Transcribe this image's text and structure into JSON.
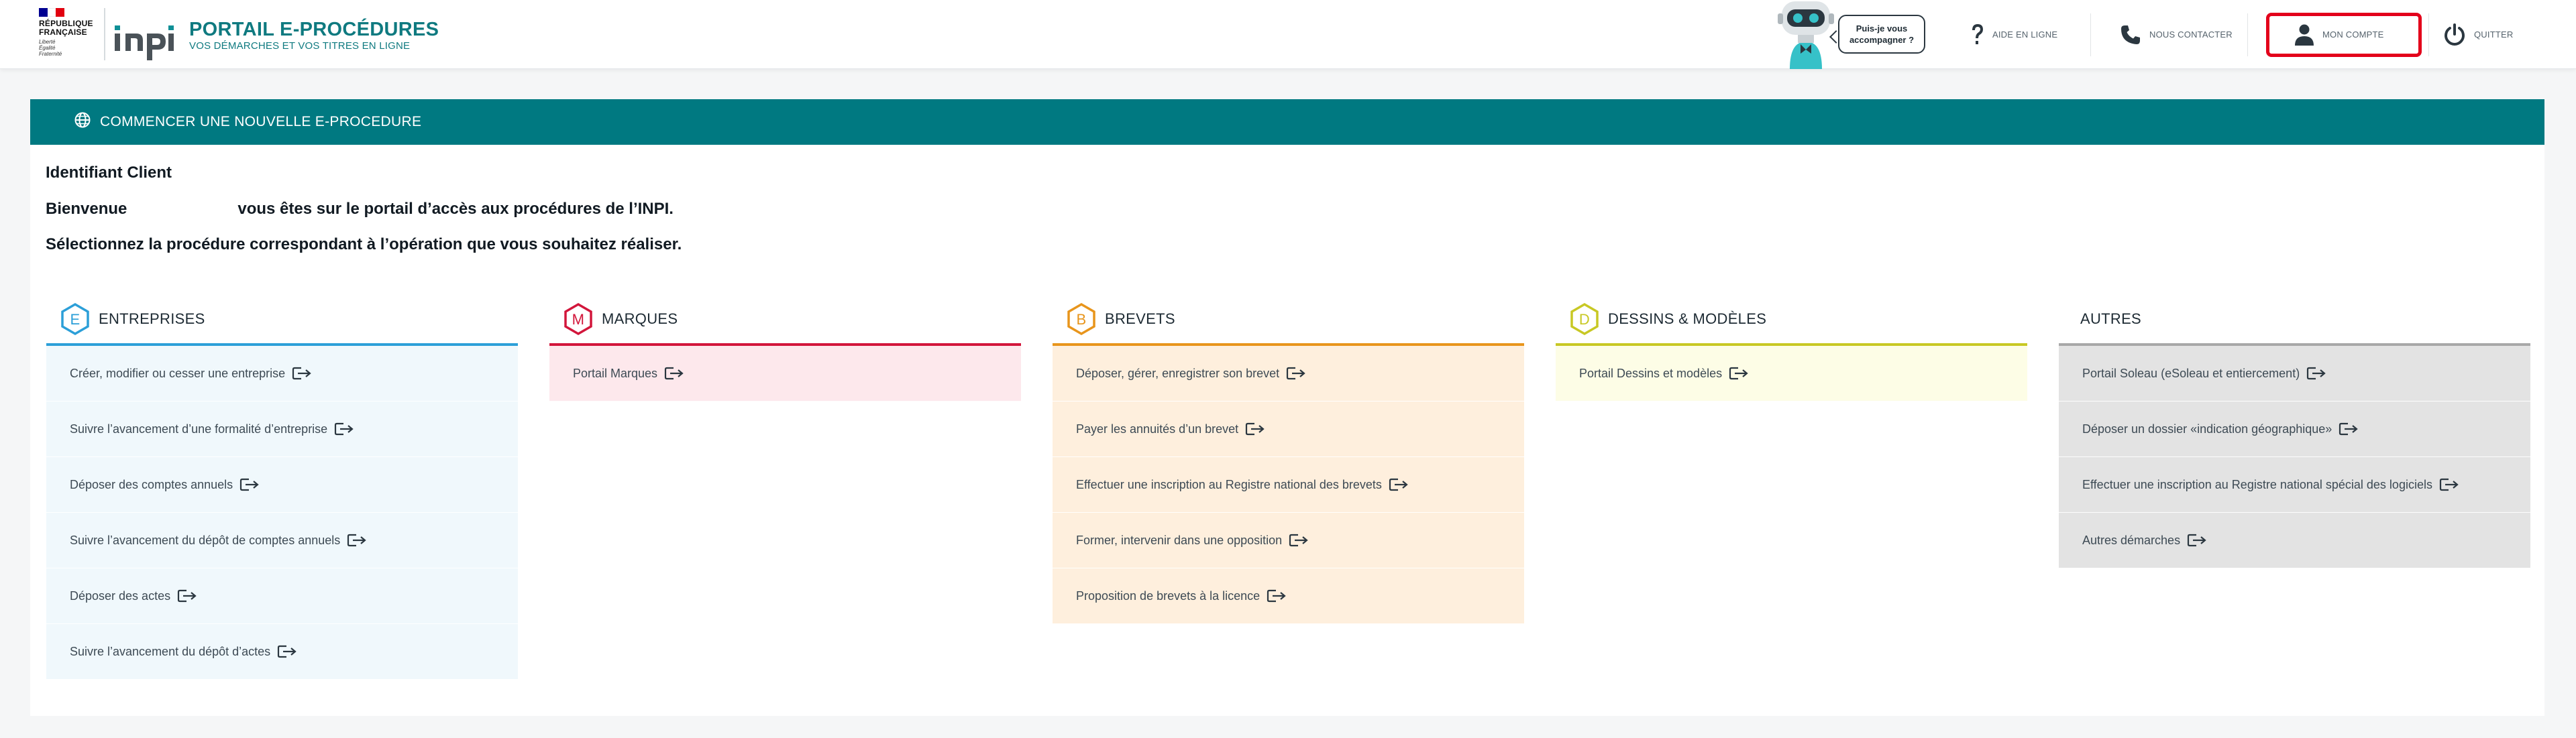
{
  "header": {
    "republique_lines": [
      "RÉPUBLIQUE",
      "FRANÇAISE"
    ],
    "motto_lines": [
      "Liberté",
      "Égalité",
      "Fraternité"
    ],
    "brand": "inpi",
    "portal_title": "PORTAIL E-PROCÉDURES",
    "portal_subtitle": "VOS DÉMARCHES ET VOS TITRES EN LIGNE",
    "assistant_bubble_line1": "Puis-je vous",
    "assistant_bubble_line2": "accompagner ?",
    "nav": {
      "help": "AIDE EN LIGNE",
      "contact": "NOUS CONTACTER",
      "account": "MON COMPTE",
      "quit": "QUITTER"
    }
  },
  "bar": {
    "label": "COMMENCER UNE NOUVELLE E-PROCEDURE"
  },
  "intro": {
    "client_id": "Identifiant Client",
    "welcome_prefix": "Bienvenue",
    "welcome_suffix": "vous êtes sur le portail d’accès aux procédures de l’INPI.",
    "select_text": "Sélectionnez la procédure correspondant à l’opération que vous souhaitez réaliser."
  },
  "columns": [
    {
      "letter": "E",
      "title": "ENTREPRISES",
      "color": "#2c9fd8",
      "bg": "#f0f8fc",
      "items": [
        "Créer, modifier ou cesser une entreprise",
        "Suivre l’avancement d’une formalité d’entreprise",
        "Déposer des comptes annuels",
        "Suivre l’avancement du dépôt de comptes annuels",
        "Déposer des actes",
        "Suivre l’avancement du dépôt d’actes"
      ]
    },
    {
      "letter": "M",
      "title": "MARQUES",
      "color": "#d2163b",
      "bg": "#fde8ec",
      "items": [
        "Portail Marques"
      ]
    },
    {
      "letter": "B",
      "title": "BREVETS",
      "color": "#e8951c",
      "bg": "#feefdd",
      "items": [
        "Déposer, gérer, enregistrer son brevet",
        "Payer les annuités d’un brevet",
        "Effectuer une inscription au Registre national des brevets",
        "Former, intervenir dans une opposition",
        "Proposition de brevets à la licence"
      ]
    },
    {
      "letter": "D",
      "title": "DESSINS & MODÈLES",
      "color": "#c8c824",
      "bg": "#fdfde6",
      "items": [
        "Portail Dessins et modèles"
      ]
    },
    {
      "letter": "",
      "title": "AUTRES",
      "color": "#a8a8a8",
      "bg": "#e3e3e3",
      "items": [
        "Portail Soleau (eSoleau et entiercement)",
        "Déposer un dossier «indication géographique»",
        "Effectuer une inscription au Registre national spécial des logiciels",
        "Autres démarches"
      ]
    }
  ]
}
